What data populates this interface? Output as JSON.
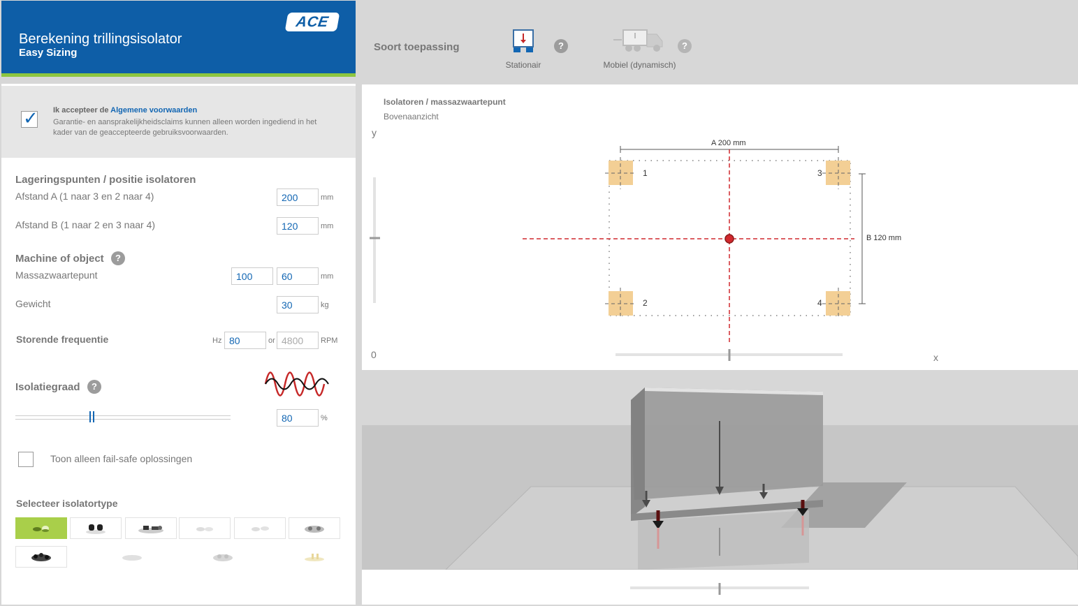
{
  "header": {
    "title": "Berekening trillingsisolator",
    "subtitle": "Easy Sizing",
    "logo_text": "ACE"
  },
  "application": {
    "label": "Soort toepassing",
    "options": [
      {
        "label": "Stationair",
        "icon": "stationary-icon"
      },
      {
        "label": "Mobiel (dynamisch)",
        "icon": "mobile-truck-icon"
      }
    ],
    "help_glyph": "?"
  },
  "terms": {
    "accept_prefix": "Ik accepteer de ",
    "accept_link": "Algemene voorwaarden",
    "note": "Garantie- en aansprakelijkheidsclaims kunnen alleen worden ingediend in het kader van de geaccepteerde gebruiksvoorwaarden.",
    "checked": true
  },
  "mounting": {
    "heading": "Lageringspunten / positie isolatoren",
    "distance_a_label": "Afstand A (1 naar 3 en 2 naar 4)",
    "distance_a_value": "200",
    "distance_b_label": "Afstand B (1 naar 2 en 3 naar 4)",
    "distance_b_value": "120",
    "unit": "mm"
  },
  "machine": {
    "heading": "Machine of object",
    "cog_label": "Massazwaartepunt",
    "cog_x": "100",
    "cog_y": "60",
    "cog_unit": "mm",
    "weight_label": "Gewicht",
    "weight_value": "30",
    "weight_unit": "kg"
  },
  "frequency": {
    "heading": "Storende frequentie",
    "hz_label": "Hz",
    "hz_value": "80",
    "or_label": "or",
    "rpm_value": "4800",
    "rpm_label": "RPM"
  },
  "isolation": {
    "heading": "Isolatiegraad",
    "value": "80",
    "unit": "%",
    "level": 0.35
  },
  "failsafe": {
    "label": "Toon alleen fail-safe oplossingen",
    "checked": false
  },
  "isolator_types": {
    "heading": "Selecteer isolatortype",
    "selected_index": 0
  },
  "topview": {
    "title": "Isolatoren / massazwaartepunt",
    "subtitle": "Bovenaanzicht",
    "y_axis": "y",
    "x_axis": "x",
    "origin": "0",
    "dim_a": "A 200 mm",
    "dim_b": "B 120 mm",
    "points": [
      "1",
      "2",
      "3",
      "4"
    ]
  },
  "colors": {
    "brand_blue": "#0e5ea7",
    "accent_green": "#8dc63f",
    "selected_tile": "#a9cf4a",
    "isolator_pad": "#f3cf95",
    "cog_red": "#d1282e"
  }
}
